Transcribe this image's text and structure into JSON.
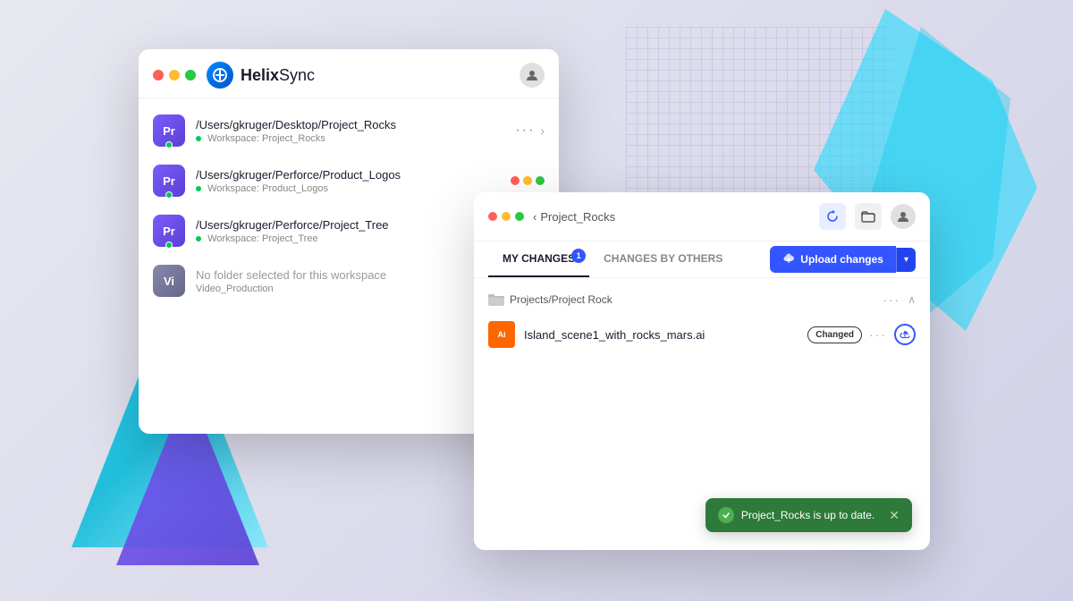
{
  "app": {
    "name": "HelixSync",
    "name_bold": "Helix",
    "name_light": "Sync"
  },
  "background": {
    "color": "#e8e8f2"
  },
  "window_main": {
    "title": "HelixSync",
    "account_icon": "👤",
    "workspaces": [
      {
        "id": "pr1",
        "initials": "Pr",
        "path": "/Users/gkruger/Desktop/Project_Rocks",
        "workspace_label": "Workspace:",
        "workspace_name": "Project_Rocks",
        "has_dot": true,
        "has_chevron": true
      },
      {
        "id": "pr2",
        "initials": "Pr",
        "path": "/Users/gkruger/Perforce/Product_Logos",
        "workspace_label": "Workspace:",
        "workspace_name": "Product_Logos",
        "has_dot": true,
        "has_chevron": false
      },
      {
        "id": "pr3",
        "initials": "Pr",
        "path": "/Users/gkruger/Perforce/Project_Tree",
        "workspace_label": "Workspace:",
        "workspace_name": "Project_Tree",
        "has_dot": true,
        "has_chevron": false
      },
      {
        "id": "vi",
        "initials": "Vi",
        "path": "No folder selected for this workspace",
        "workspace_label": "",
        "workspace_name": "Video_Production",
        "has_dot": false,
        "has_chevron": false,
        "is_vi": true
      }
    ]
  },
  "window_detail": {
    "back_label": "< Project_Rocks",
    "project_name": "Project_Rocks",
    "tabs": [
      {
        "id": "my-changes",
        "label": "MY CHANGES",
        "active": true,
        "badge": "1"
      },
      {
        "id": "changes-by-others",
        "label": "CHANGES BY OTHERS",
        "active": false,
        "badge": null
      }
    ],
    "upload_btn_label": "Upload changes",
    "upload_icon": "☁",
    "folder": {
      "name": "Projects/Project Rock",
      "dots": "···",
      "chevron": "∧"
    },
    "files": [
      {
        "id": "f1",
        "icon_text": "Ai",
        "icon_color": "#ff6600",
        "name": "Island_scene1_with_rocks_mars.ai",
        "status": "Changed",
        "has_upload": true
      }
    ],
    "toast": {
      "message": "Project_Rocks is up to date.",
      "color": "#2d7a3a"
    }
  }
}
